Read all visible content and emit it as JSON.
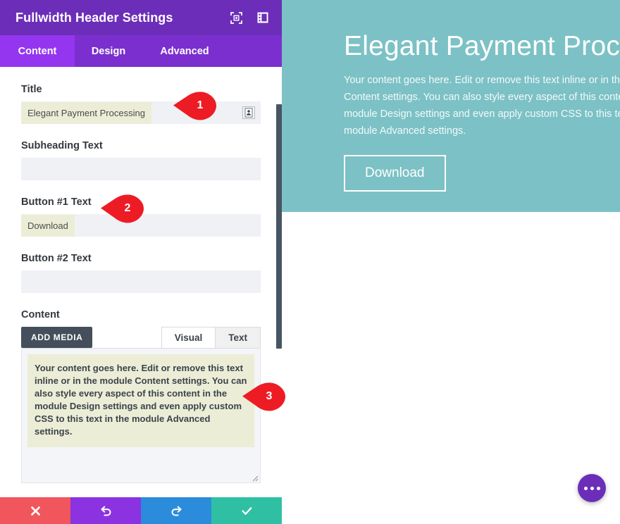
{
  "panel": {
    "title": "Fullwidth Header Settings",
    "header_icons": [
      {
        "name": "focus-target-icon",
        "label": "Focus"
      },
      {
        "name": "panel-layout-icon",
        "label": "Layout"
      }
    ],
    "tabs": [
      {
        "id": "content",
        "label": "Content",
        "active": true
      },
      {
        "id": "design",
        "label": "Design",
        "active": false
      },
      {
        "id": "advanced",
        "label": "Advanced",
        "active": false
      }
    ],
    "fields": {
      "title": {
        "label": "Title",
        "value": "Elegant Payment Processing",
        "placeholder": "",
        "dynamic_icon": "dynamic-content-icon"
      },
      "subheading": {
        "label": "Subheading Text",
        "value": "",
        "placeholder": ""
      },
      "button1": {
        "label": "Button #1 Text",
        "value": "Download",
        "placeholder": ""
      },
      "button2": {
        "label": "Button #2 Text",
        "value": "",
        "placeholder": ""
      },
      "content": {
        "label": "Content",
        "add_media_label": "ADD MEDIA",
        "editor_tabs": [
          {
            "id": "visual",
            "label": "Visual",
            "active": true
          },
          {
            "id": "text",
            "label": "Text",
            "active": false
          }
        ],
        "body": "Your content goes here. Edit or remove this text inline or in the module Content settings. You can also style every aspect of this content in the module Design settings and even apply custom CSS to this text in the module Advanced settings."
      }
    },
    "actions": [
      {
        "id": "close",
        "icon": "close-icon",
        "color": "#f0565b"
      },
      {
        "id": "undo",
        "icon": "undo-icon",
        "color": "#8b33e0"
      },
      {
        "id": "redo",
        "icon": "redo-icon",
        "color": "#2b8cdb"
      },
      {
        "id": "save",
        "icon": "check-icon",
        "color": "#2fc0a4"
      }
    ]
  },
  "preview": {
    "background_color": "#7cc1c5",
    "heading": "Elegant Payment Processing",
    "body": "Your content goes here. Edit or remove this text inline or in the module Content settings. You can also style every aspect of this content in the module Design settings and even apply custom CSS to this text in the module Advanced settings.",
    "button_label": "Download",
    "fab": {
      "name": "more-options-fab",
      "color": "#6c2eb9"
    }
  },
  "callouts": [
    {
      "id": "1",
      "number": "1"
    },
    {
      "id": "2",
      "number": "2"
    },
    {
      "id": "3",
      "number": "3"
    }
  ]
}
